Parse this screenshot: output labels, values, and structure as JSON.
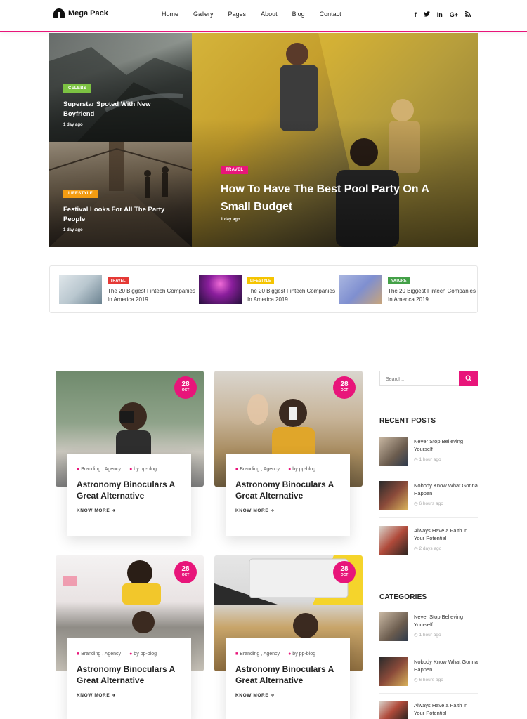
{
  "header": {
    "logo_text": "Mega Pack",
    "nav": [
      "Home",
      "Gallery",
      "Pages",
      "About",
      "Blog",
      "Contact"
    ],
    "social": [
      {
        "icon": "facebook-icon",
        "glyph": "f"
      },
      {
        "icon": "twitter-icon",
        "glyph": "t"
      },
      {
        "icon": "linkedin-icon",
        "glyph": "in"
      },
      {
        "icon": "google-plus-icon",
        "glyph": "G+"
      },
      {
        "icon": "rss-icon",
        "glyph": "rss"
      }
    ]
  },
  "hero": {
    "tiles": [
      {
        "category": "CELEBS",
        "title": "Superstar Spoted With New Boyfriend",
        "date": "1 day ago",
        "badge_color": "#7cc242"
      },
      {
        "category": "LIFESTYLE",
        "title": "Festival Looks For All The Party People",
        "date": "1 day ago",
        "badge_color": "#f39c12"
      },
      {
        "category": "TRAVEL",
        "title": "How To Have The Best Pool Party On A Small Budget",
        "date": "1 day ago",
        "badge_color": "#e8157a"
      }
    ]
  },
  "featured": [
    {
      "category": "TRAVEL",
      "title": "The 20 Biggest Fintech Companies In America 2019",
      "badge_color": "#e53935"
    },
    {
      "category": "LIFESTYLE",
      "title": "The 20 Biggest Fintech Companies In America 2019",
      "badge_color": "#f5c400"
    },
    {
      "category": "NATURE",
      "title": "The 20 Biggest Fintech Companies In America 2019",
      "badge_color": "#43a047"
    }
  ],
  "cards": [
    {
      "day": "28",
      "month": "OCT",
      "category": "Branding , Agency",
      "author": "by pp-blog",
      "title": "Astronomy Binoculars A Great Alternative",
      "more": "KNOW MORE"
    },
    {
      "day": "28",
      "month": "OCT",
      "category": "Branding , Agency",
      "author": "by pp-blog",
      "title": "Astronomy Binoculars A Great Alternative",
      "more": "KNOW MORE"
    },
    {
      "day": "28",
      "month": "OCT",
      "category": "Branding , Agency",
      "author": "by pp-blog",
      "title": "Astronomy Binoculars A Great Alternative",
      "more": "KNOW MORE"
    },
    {
      "day": "28",
      "month": "OCT",
      "category": "Branding , Agency",
      "author": "by pp-blog",
      "title": "Astronomy Binoculars A Great Alternative",
      "more": "KNOW MORE"
    }
  ],
  "sidebar": {
    "search_placeholder": "Search..",
    "recent_heading": "RECENT POSTS",
    "recent": [
      {
        "title": "Never Stop Believing Yourself",
        "time": "1 hour ago"
      },
      {
        "title": "Nobody Know What Gonna Happen",
        "time": "6 hours ago"
      },
      {
        "title": "Always Have a Faith in Your Potential",
        "time": "2 days ago"
      }
    ],
    "categories_heading": "CATEGORIES",
    "categories": [
      {
        "title": "Never Stop Believing Yourself",
        "time": "1 hour ago"
      },
      {
        "title": "Nobody Know What Gonna Happen",
        "time": "6 hours ago"
      },
      {
        "title": "Always Have a Faith in Your Potential",
        "time": ""
      }
    ]
  },
  "colors": {
    "accent": "#e8157a"
  }
}
